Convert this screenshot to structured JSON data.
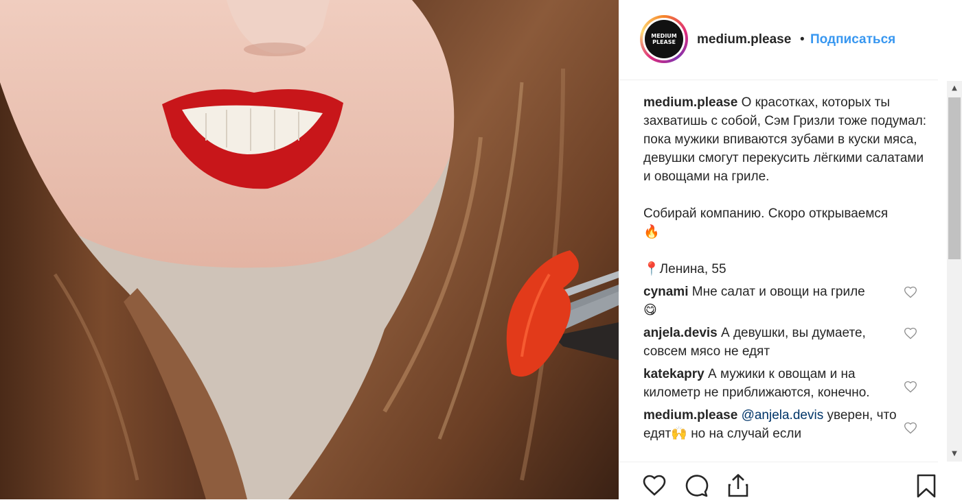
{
  "post": {
    "username": "medium.please",
    "separator": "•",
    "follow_label": "Подписаться",
    "avatar_text": "MEDIUM PLEASE"
  },
  "caption": {
    "username": "medium.please",
    "text": "О красотках, которых ты захватишь с собой, Сэм Гризли тоже подумал: пока мужики впиваются зубами в куски мяса, девушки смогут перекусить лёгкими салатами и овощами на гриле.",
    "paragraph2": "Собирай компанию. Скоро открываемся",
    "paragraph2_emoji": "🔥",
    "location_pin": "📍",
    "location": "Ленина, 55"
  },
  "comments": [
    {
      "username": "cynami",
      "text": "Мне салат и овощи на гриле",
      "emoji": "😋"
    },
    {
      "username": "anjela.devis",
      "text": "А девушки, вы думаете, совсем мясо не едят",
      "emoji": ""
    },
    {
      "username": "katekapry",
      "text": "А мужики к овощам и на километр не приближаются, конечно.",
      "emoji": ""
    },
    {
      "username": "medium.please",
      "mention": "@anjela.devis",
      "text": "уверен, что едят",
      "emoji": "🙌",
      "text2": "но на случай если"
    }
  ],
  "scrollbar": {
    "up_arrow": "▲",
    "down_arrow": "▼"
  },
  "icons": {
    "like": "heart-icon",
    "comment": "comment-icon",
    "share": "share-icon",
    "save": "bookmark-icon"
  },
  "colors": {
    "follow": "#3897f0",
    "lips": "#c8161a",
    "text": "#262626"
  }
}
